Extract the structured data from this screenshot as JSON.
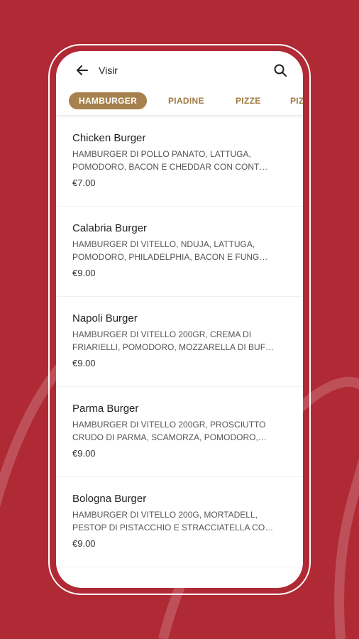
{
  "colors": {
    "background": "#b02a35",
    "accent": "#a6814d",
    "tab_text": "#a07a44"
  },
  "header": {
    "title": "Visir",
    "back_icon": "arrow-left-icon",
    "search_icon": "search-icon"
  },
  "tabs": [
    {
      "label": "HAMBURGER",
      "active": true
    },
    {
      "label": "PIADINE",
      "active": false
    },
    {
      "label": "PIZZE",
      "active": false
    },
    {
      "label": "PIZ",
      "active": false
    }
  ],
  "items": [
    {
      "name": "Chicken Burger",
      "description": "HAMBURGER DI POLLO PANATO, LATTUGA, POMODORO, BACON E CHEDDAR CON CONT…",
      "price": "€7.00"
    },
    {
      "name": "Calabria Burger",
      "description": "HAMBURGER DI VITELLO, NDUJA, LATTUGA, POMODORO, PHILADELPHIA, BACON E FUNG…",
      "price": "€9.00"
    },
    {
      "name": "Napoli Burger",
      "description": "HAMBURGER DI VITELLO 200GR, CREMA DI FRIARIELLI, POMODORO, MOZZARELLA DI BUF…",
      "price": "€9.00"
    },
    {
      "name": "Parma Burger",
      "description": "HAMBURGER DI VITELLO 200GR, PROSCIUTTO CRUDO DI PARMA, SCAMORZA, POMODORO,…",
      "price": "€9.00"
    },
    {
      "name": "Bologna Burger",
      "description": "HAMBURGER DI VITELLO 200G, MORTADELL, PESTOP DI PISTACCHIO E STRACCIATELLA CO…",
      "price": "€9.00"
    }
  ]
}
